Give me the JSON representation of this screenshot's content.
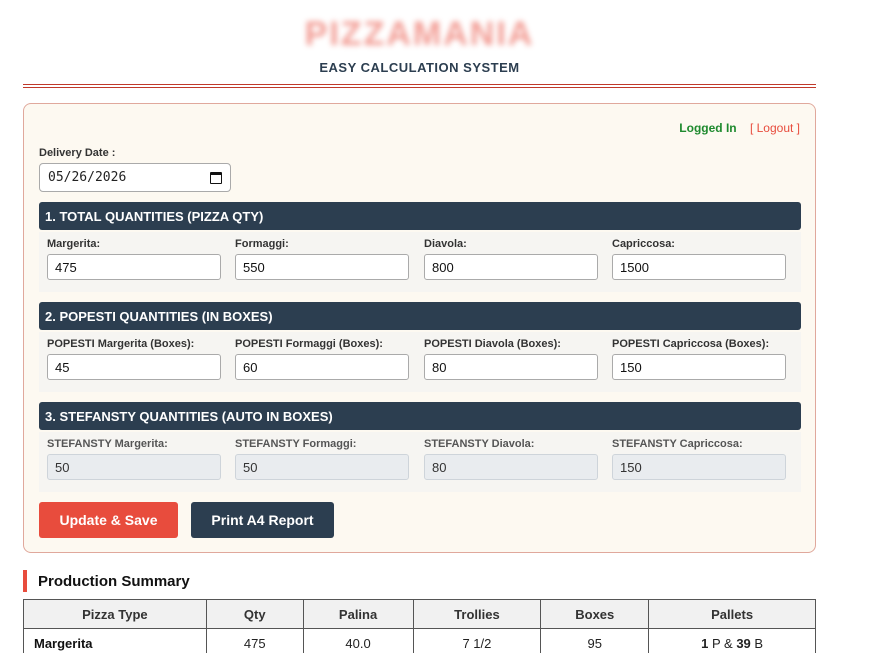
{
  "header": {
    "brand": "PIZZAMANIA",
    "subtitle": "EASY CALCULATION SYSTEM"
  },
  "auth": {
    "status": "Logged In",
    "logout": "[ Logout ]"
  },
  "delivery": {
    "label": "Delivery Date :",
    "value": "05/26/2026"
  },
  "sections": {
    "total": {
      "title": "1. TOTAL QUANTITIES (PIZZA QTY)",
      "fields": [
        {
          "label": "Margerita:",
          "value": "475"
        },
        {
          "label": "Formaggi:",
          "value": "550"
        },
        {
          "label": "Diavola:",
          "value": "800"
        },
        {
          "label": "Capriccosa:",
          "value": "1500"
        }
      ]
    },
    "popesti": {
      "title": "2. POPESTI QUANTITIES (IN BOXES)",
      "fields": [
        {
          "label": "POPESTI Margerita (Boxes):",
          "value": "45"
        },
        {
          "label": "POPESTI Formaggi (Boxes):",
          "value": "60"
        },
        {
          "label": "POPESTI Diavola (Boxes):",
          "value": "80"
        },
        {
          "label": "POPESTI Capriccosa (Boxes):",
          "value": "150"
        }
      ]
    },
    "stefansty": {
      "title": "3. STEFANSTY QUANTITIES (AUTO IN BOXES)",
      "fields": [
        {
          "label": "STEFANSTY Margerita:",
          "value": "50"
        },
        {
          "label": "STEFANSTY Formaggi:",
          "value": "50"
        },
        {
          "label": "STEFANSTY Diavola:",
          "value": "80"
        },
        {
          "label": "STEFANSTY Capriccosa:",
          "value": "150"
        }
      ]
    }
  },
  "buttons": {
    "save": "Update & Save",
    "print": "Print A4 Report"
  },
  "summary": {
    "title": "Production Summary",
    "headers": [
      "Pizza Type",
      "Qty",
      "Palina",
      "Trollies",
      "Boxes",
      "Pallets"
    ],
    "rows": [
      {
        "type": "Margerita",
        "qty": "475",
        "palina": "40.0",
        "trollies": "7 1/2",
        "boxes": "95",
        "pallets_p": "1",
        "pallets_p_unit": "P",
        "pallets_amp": "&",
        "pallets_b": "39",
        "pallets_b_unit": "B"
      }
    ]
  },
  "colors": {
    "accent": "#e84c3d",
    "navy": "#2c3e50",
    "success": "#1e8a2e"
  }
}
